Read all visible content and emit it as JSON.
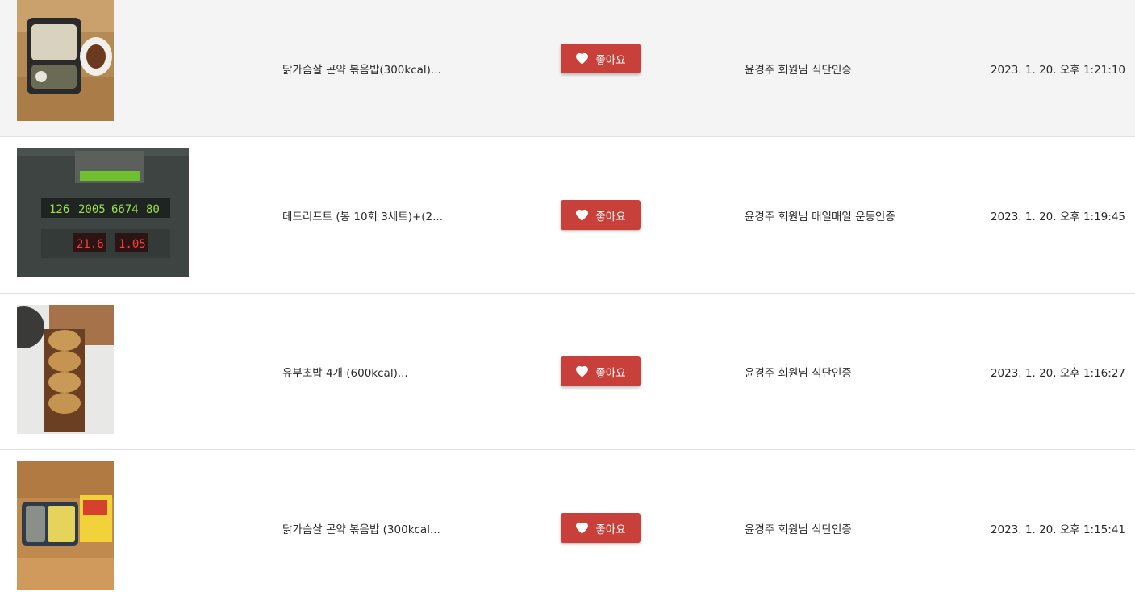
{
  "colors": {
    "like_button": "#c9403a",
    "highlight_row": "#f4f4f4"
  },
  "posts": [
    {
      "title": "닭가슴살 곤약 볶음밥(300kcal)...",
      "like_label": "좋아요",
      "like_icon": "heart-icon",
      "category": "윤경주 회원님 식단인증",
      "timestamp": "2023. 1. 20. 오후 1:21:10"
    },
    {
      "title": "데드리프트 (봉 10회 3세트)+(2...",
      "like_label": "좋아요",
      "like_icon": "heart-icon",
      "category": "윤경주 회원님 매일매일 운동인증",
      "timestamp": "2023. 1. 20. 오후 1:19:45",
      "photo_readouts": [
        "126",
        "2005",
        "6674",
        "80",
        "21.6",
        "1.05"
      ]
    },
    {
      "title": "유부초밥 4개 (600kcal)...",
      "like_label": "좋아요",
      "like_icon": "heart-icon",
      "category": "윤경주 회원님 식단인증",
      "timestamp": "2023. 1. 20. 오후 1:16:27"
    },
    {
      "title": "닭가슴살 곤약 볶음밥 (300kcal...",
      "like_label": "좋아요",
      "like_icon": "heart-icon",
      "category": "윤경주 회원님 식단인증",
      "timestamp": "2023. 1. 20. 오후 1:15:41"
    }
  ]
}
